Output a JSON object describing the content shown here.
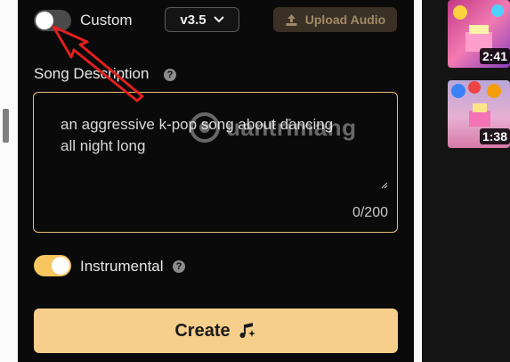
{
  "header": {
    "custom_label": "Custom",
    "custom_on": false,
    "version_label": "v3.5",
    "upload_label": "Upload Audio"
  },
  "description": {
    "label": "Song Description",
    "value": "an aggressive k-pop song about dancing all night long",
    "counter": "0/200"
  },
  "watermark": {
    "text": "uantrimang"
  },
  "instrumental": {
    "label": "Instrumental",
    "on": true
  },
  "create": {
    "label": "Create"
  },
  "sidebar": {
    "videos": [
      {
        "duration": "2:41"
      },
      {
        "duration": "1:38"
      }
    ]
  },
  "colors": {
    "accent": "#f7cf8c",
    "border_accent": "#e8c07a",
    "annotation_arrow": "#e0201b",
    "panel_bg": "#0a0a0a"
  }
}
